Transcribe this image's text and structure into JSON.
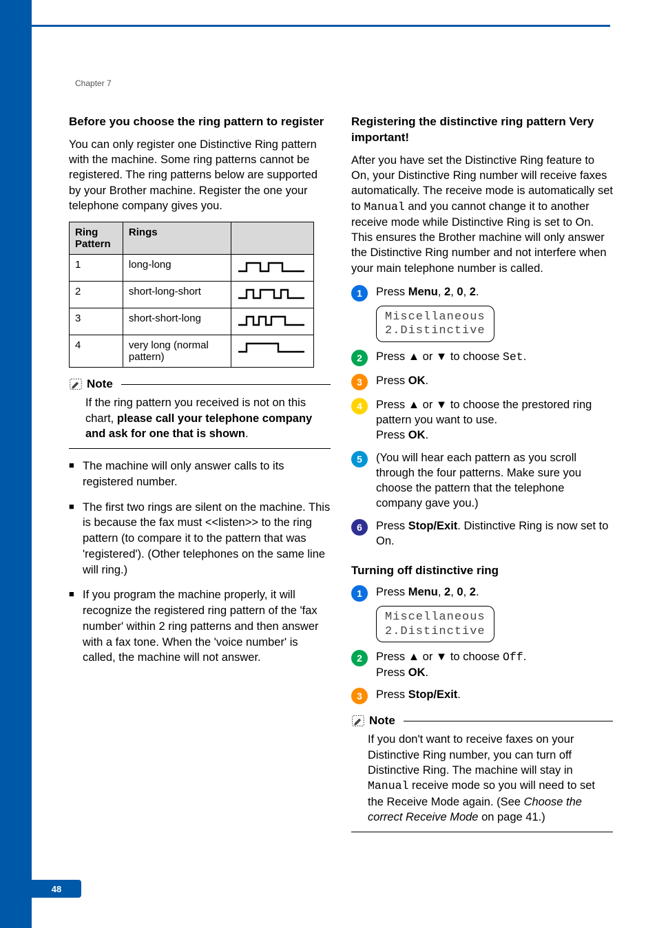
{
  "chapter_label": "Chapter 7",
  "page_number": "48",
  "left": {
    "heading": "Before you choose the ring pattern to register",
    "intro": "You can only register one Distinctive Ring pattern with the machine. Some ring patterns cannot be registered. The ring patterns below are supported by your Brother machine. Register the one your telephone company gives you.",
    "table": {
      "head": {
        "col1": "Ring Pattern",
        "col2": "Rings",
        "col3": ""
      },
      "rows": [
        {
          "num": "1",
          "desc": "long-long"
        },
        {
          "num": "2",
          "desc": "short-long-short"
        },
        {
          "num": "3",
          "desc": "short-short-long"
        },
        {
          "num": "4",
          "desc": "very long (normal pattern)"
        }
      ]
    },
    "note_label": "Note",
    "note_body_parts": {
      "p1": "If the ring pattern you received is not on this chart, ",
      "bold": "please call your telephone company and ask for one that is shown",
      "p2": "."
    },
    "bullets": [
      "The machine will only answer calls to its registered number.",
      "The first two rings are silent on the machine. This is because the fax must <<listen>> to the ring pattern (to compare it to the pattern that was 'registered'). (Other telephones on the same line will ring.)",
      "If you program the machine properly, it will recognize the registered ring pattern of the 'fax number' within 2 ring patterns and then answer with a fax tone. When the 'voice number' is called, the machine will not answer."
    ]
  },
  "right": {
    "heading": "Registering the distinctive ring pattern Very important!",
    "intro_parts": {
      "a": "After you have set the Distinctive Ring feature to On, your Distinctive Ring number will receive faxes automatically. The receive mode is automatically set to ",
      "mono1": "Manual",
      "b": " and you cannot change it to another receive mode while Distinctive Ring is set to On. This ensures the Brother machine will only answer the Distinctive Ring number and not interfere when your main telephone number is called."
    },
    "steps_main": {
      "s1_a": "Press ",
      "s1_b": "Menu",
      "s1_c": ", ",
      "s1_d": "2",
      "s1_e": ", ",
      "s1_f": "0",
      "s1_g": ", ",
      "s1_h": "2",
      "s1_i": ".",
      "lcd1_l1": "Miscellaneous",
      "lcd1_l2": "2.Distinctive",
      "s2_a": "Press ▲ or ▼ to choose ",
      "s2_mono": "Set",
      "s2_b": ".",
      "s3_a": "Press ",
      "s3_b": "OK",
      "s3_c": ".",
      "s4": "Press ▲ or ▼ to choose the prestored ring pattern you want to use.",
      "s4b_a": "Press ",
      "s4b_b": "OK",
      "s4b_c": ".",
      "s5": "(You will hear each pattern as you scroll through the four patterns. Make sure you choose the pattern that the telephone company gave you.)",
      "s6_a": "Press ",
      "s6_b": "Stop/Exit",
      "s6_c": ". Distinctive Ring is now set to On."
    },
    "sub_heading": "Turning off distinctive ring",
    "steps_off": {
      "s1_a": "Press ",
      "s1_b": "Menu",
      "s1_c": ", ",
      "s1_d": "2",
      "s1_e": ", ",
      "s1_f": "0",
      "s1_g": ", ",
      "s1_h": "2",
      "s1_i": ".",
      "lcd_l1": "Miscellaneous",
      "lcd_l2": "2.Distinctive",
      "s2_a": "Press ▲ or ▼ to choose ",
      "s2_mono": "Off",
      "s2_b": ".",
      "s2c_a": "Press ",
      "s2c_b": "OK",
      "s2c_c": ".",
      "s3_a": "Press ",
      "s3_b": "Stop/Exit",
      "s3_c": "."
    },
    "note_label": "Note",
    "note_body_parts": {
      "a": "If you don't want to receive faxes on your Distinctive Ring number, you can turn off Distinctive Ring. The machine will stay in ",
      "mono": "Manual",
      "b": " receive mode so you will need to set the Receive Mode again. (See ",
      "italic": "Choose the correct Receive Mode",
      "c": " on page 41.)"
    }
  }
}
